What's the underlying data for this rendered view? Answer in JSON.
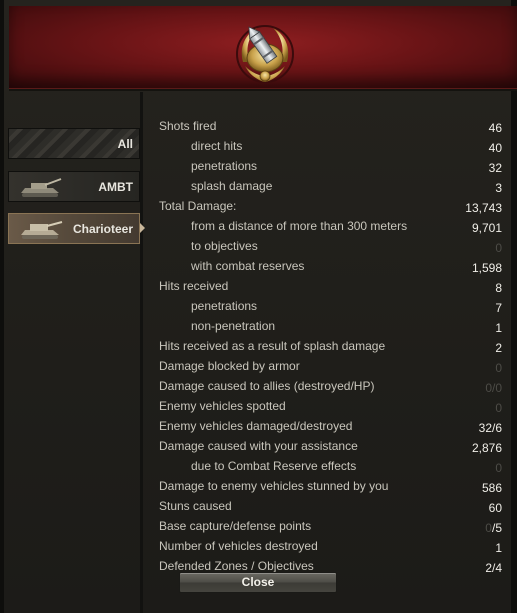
{
  "tabs": [
    {
      "label": "All",
      "icon": "stripes-pattern-icon"
    },
    {
      "label": "AMBT",
      "icon": "tank-icon"
    },
    {
      "label": "Charioteer",
      "icon": "tank-icon",
      "selected": true
    }
  ],
  "stats": [
    {
      "label": "Shots fired",
      "value": "46",
      "indent": 0
    },
    {
      "label": "direct hits",
      "value": "40",
      "indent": 1
    },
    {
      "label": "penetrations",
      "value": "32",
      "indent": 1
    },
    {
      "label": "splash damage",
      "value": "3",
      "indent": 1
    },
    {
      "label": "Total Damage:",
      "value": "13,743",
      "indent": 0
    },
    {
      "label": "from a distance of more than 300 meters",
      "value": "9,701",
      "indent": 1
    },
    {
      "label": "to objectives",
      "value": "0",
      "indent": 1,
      "dim": true
    },
    {
      "label": "with combat reserves",
      "value": "1,598",
      "indent": 1
    },
    {
      "label": "Hits received",
      "value": "8",
      "indent": 0
    },
    {
      "label": "penetrations",
      "value": "7",
      "indent": 1
    },
    {
      "label": "non-penetration",
      "value": "1",
      "indent": 1
    },
    {
      "label": "Hits received as a result of splash damage",
      "value": "2",
      "indent": 0
    },
    {
      "label": "Damage blocked by armor",
      "value": "0",
      "indent": 0,
      "dim": true
    },
    {
      "label": "Damage caused to allies (destroyed/HP)",
      "value": "0/0",
      "indent": 0,
      "dim": true
    },
    {
      "label": "Enemy vehicles spotted",
      "value": "0",
      "indent": 0,
      "dim": true
    },
    {
      "label": "Enemy vehicles damaged/destroyed",
      "value": "32/6",
      "indent": 0
    },
    {
      "label": "Damage caused with your assistance",
      "value": "2,876",
      "indent": 0
    },
    {
      "label": "due to Combat Reserve effects",
      "value": "0",
      "indent": 1,
      "dim": true
    },
    {
      "label": "Damage to enemy vehicles stunned by you",
      "value": "586",
      "indent": 0
    },
    {
      "label": "Stuns caused",
      "value": "60",
      "indent": 0
    },
    {
      "label": "Base capture/defense points",
      "value_dim": "0",
      "value": "/5",
      "indent": 0
    },
    {
      "label": "Number of vehicles destroyed",
      "value": "1",
      "indent": 0
    },
    {
      "label": "Defended Zones / Objectives",
      "value": "2/4",
      "indent": 0
    }
  ],
  "close_label": "Close",
  "colors": {
    "banner": "#7a1819",
    "label": "#c9c6bc",
    "value": "#f0eee8",
    "dim_value": "#4d4c47",
    "selected_tab": "#5e4f3f"
  },
  "banner_icon": "shell-medal-icon"
}
